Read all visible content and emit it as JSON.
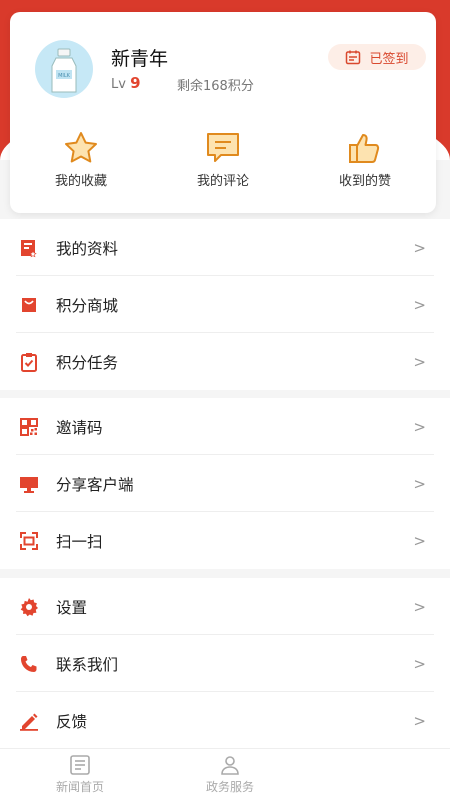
{
  "profile": {
    "username": "新青年",
    "level_prefix": "Lv",
    "level_value": "9",
    "points_text": "剩余168积分",
    "sign_label": "已签到"
  },
  "stats": [
    {
      "label": "我的收藏",
      "icon": "star-icon"
    },
    {
      "label": "我的评论",
      "icon": "comment-icon"
    },
    {
      "label": "收到的赞",
      "icon": "thumbs-up-icon"
    }
  ],
  "menu": {
    "group1": [
      {
        "label": "我的资料",
        "icon": "profile-doc-icon"
      },
      {
        "label": "积分商城",
        "icon": "shopping-bag-icon"
      },
      {
        "label": "积分任务",
        "icon": "task-clipboard-icon"
      }
    ],
    "group2": [
      {
        "label": "邀请码",
        "icon": "qr-code-icon"
      },
      {
        "label": "分享客户端",
        "icon": "monitor-icon"
      },
      {
        "label": "扫一扫",
        "icon": "scan-icon"
      }
    ],
    "group3": [
      {
        "label": "设置",
        "icon": "gear-icon"
      },
      {
        "label": "联系我们",
        "icon": "phone-icon"
      },
      {
        "label": "反馈",
        "icon": "edit-pen-icon"
      }
    ],
    "chevron": ">"
  },
  "bottom_nav": [
    {
      "label": "新闻首页",
      "icon": "news-icon"
    },
    {
      "label": "政务服务",
      "icon": "service-person-icon"
    }
  ],
  "colors": {
    "brand_red": "#d93a2b",
    "icon_red": "#e2452f",
    "accent_orange": "#f0a020"
  }
}
